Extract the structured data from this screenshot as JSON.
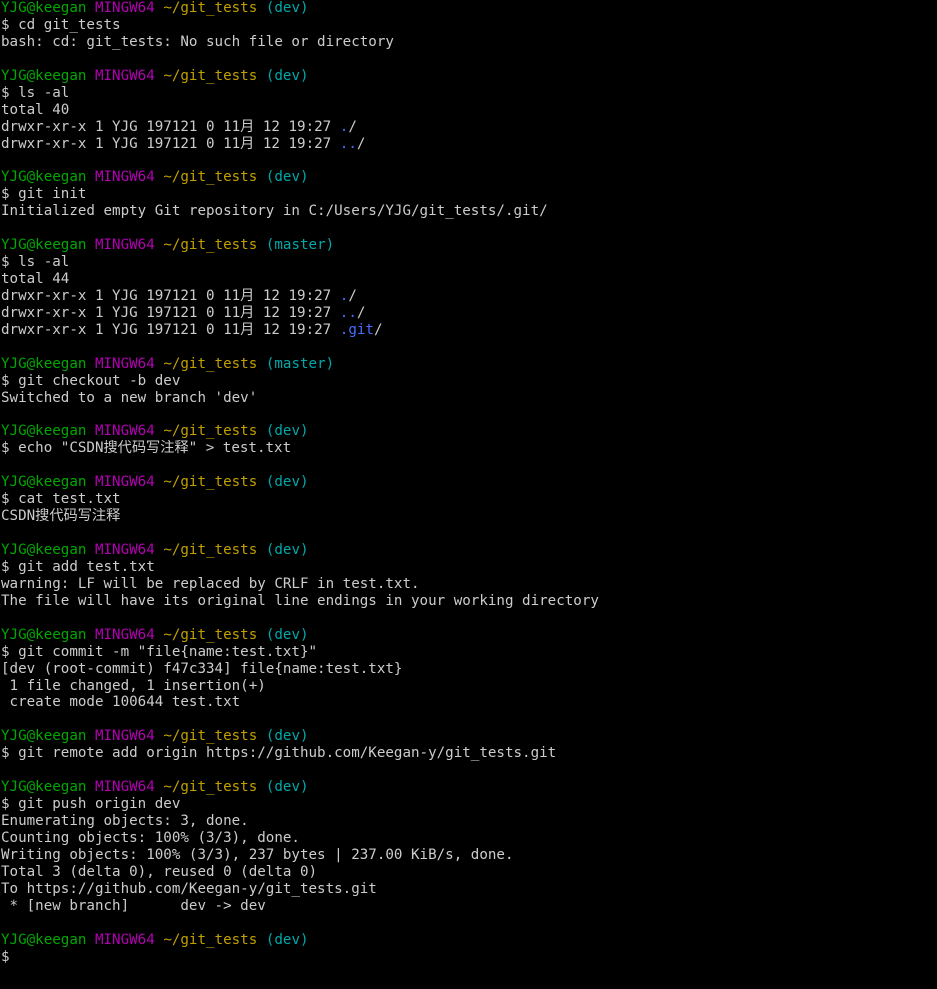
{
  "theme": {
    "background": "#000000",
    "foreground": "#cccccc",
    "prompt_user_color": "#00a800",
    "prompt_msystem_color": "#b200b2",
    "prompt_path_color": "#c0a000",
    "prompt_branch_color": "#00a8a8",
    "directory_color": "#4a6cff"
  },
  "lines": [
    {
      "kind": "prompt",
      "user": "YJG@keegan",
      "msystem": "MINGW64",
      "path": "~/git_tests",
      "branch": "(dev)"
    },
    {
      "kind": "text",
      "text": "$ cd git_tests"
    },
    {
      "kind": "text",
      "text": "bash: cd: git_tests: No such file or directory"
    },
    {
      "kind": "blank"
    },
    {
      "kind": "prompt",
      "user": "YJG@keegan",
      "msystem": "MINGW64",
      "path": "~/git_tests",
      "branch": "(dev)"
    },
    {
      "kind": "text",
      "text": "$ ls -al"
    },
    {
      "kind": "text",
      "text": "total 40"
    },
    {
      "kind": "listing",
      "prefix": "drwxr-xr-x 1 YJG 197121 0 11月 12 19:27 ",
      "name": ".",
      "suffix": "/"
    },
    {
      "kind": "listing",
      "prefix": "drwxr-xr-x 1 YJG 197121 0 11月 12 19:27 ",
      "name": "..",
      "suffix": "/"
    },
    {
      "kind": "blank"
    },
    {
      "kind": "prompt",
      "user": "YJG@keegan",
      "msystem": "MINGW64",
      "path": "~/git_tests",
      "branch": "(dev)"
    },
    {
      "kind": "text",
      "text": "$ git init"
    },
    {
      "kind": "text",
      "text": "Initialized empty Git repository in C:/Users/YJG/git_tests/.git/"
    },
    {
      "kind": "blank"
    },
    {
      "kind": "prompt",
      "user": "YJG@keegan",
      "msystem": "MINGW64",
      "path": "~/git_tests",
      "branch": "(master)"
    },
    {
      "kind": "text",
      "text": "$ ls -al"
    },
    {
      "kind": "text",
      "text": "total 44"
    },
    {
      "kind": "listing",
      "prefix": "drwxr-xr-x 1 YJG 197121 0 11月 12 19:27 ",
      "name": ".",
      "suffix": "/"
    },
    {
      "kind": "listing",
      "prefix": "drwxr-xr-x 1 YJG 197121 0 11月 12 19:27 ",
      "name": "..",
      "suffix": "/"
    },
    {
      "kind": "listing",
      "prefix": "drwxr-xr-x 1 YJG 197121 0 11月 12 19:27 ",
      "name": ".git",
      "suffix": "/"
    },
    {
      "kind": "blank"
    },
    {
      "kind": "prompt",
      "user": "YJG@keegan",
      "msystem": "MINGW64",
      "path": "~/git_tests",
      "branch": "(master)"
    },
    {
      "kind": "text",
      "text": "$ git checkout -b dev"
    },
    {
      "kind": "text",
      "text": "Switched to a new branch 'dev'"
    },
    {
      "kind": "blank"
    },
    {
      "kind": "prompt",
      "user": "YJG@keegan",
      "msystem": "MINGW64",
      "path": "~/git_tests",
      "branch": "(dev)"
    },
    {
      "kind": "text",
      "text": "$ echo \"CSDN搜代码写注释\" > test.txt"
    },
    {
      "kind": "blank"
    },
    {
      "kind": "prompt",
      "user": "YJG@keegan",
      "msystem": "MINGW64",
      "path": "~/git_tests",
      "branch": "(dev)"
    },
    {
      "kind": "text",
      "text": "$ cat test.txt"
    },
    {
      "kind": "text",
      "text": "CSDN搜代码写注释"
    },
    {
      "kind": "blank"
    },
    {
      "kind": "prompt",
      "user": "YJG@keegan",
      "msystem": "MINGW64",
      "path": "~/git_tests",
      "branch": "(dev)"
    },
    {
      "kind": "text",
      "text": "$ git add test.txt"
    },
    {
      "kind": "text",
      "text": "warning: LF will be replaced by CRLF in test.txt."
    },
    {
      "kind": "text",
      "text": "The file will have its original line endings in your working directory"
    },
    {
      "kind": "blank"
    },
    {
      "kind": "prompt",
      "user": "YJG@keegan",
      "msystem": "MINGW64",
      "path": "~/git_tests",
      "branch": "(dev)"
    },
    {
      "kind": "text",
      "text": "$ git commit -m \"file{name:test.txt}\""
    },
    {
      "kind": "text",
      "text": "[dev (root-commit) f47c334] file{name:test.txt}"
    },
    {
      "kind": "text",
      "text": " 1 file changed, 1 insertion(+)"
    },
    {
      "kind": "text",
      "text": " create mode 100644 test.txt"
    },
    {
      "kind": "blank"
    },
    {
      "kind": "prompt",
      "user": "YJG@keegan",
      "msystem": "MINGW64",
      "path": "~/git_tests",
      "branch": "(dev)"
    },
    {
      "kind": "text",
      "text": "$ git remote add origin https://github.com/Keegan-y/git_tests.git"
    },
    {
      "kind": "blank"
    },
    {
      "kind": "prompt",
      "user": "YJG@keegan",
      "msystem": "MINGW64",
      "path": "~/git_tests",
      "branch": "(dev)"
    },
    {
      "kind": "text",
      "text": "$ git push origin dev"
    },
    {
      "kind": "text",
      "text": "Enumerating objects: 3, done."
    },
    {
      "kind": "text",
      "text": "Counting objects: 100% (3/3), done."
    },
    {
      "kind": "text",
      "text": "Writing objects: 100% (3/3), 237 bytes | 237.00 KiB/s, done."
    },
    {
      "kind": "text",
      "text": "Total 3 (delta 0), reused 0 (delta 0)"
    },
    {
      "kind": "text",
      "text": "To https://github.com/Keegan-y/git_tests.git"
    },
    {
      "kind": "text",
      "text": " * [new branch]      dev -> dev"
    },
    {
      "kind": "blank"
    },
    {
      "kind": "prompt",
      "user": "YJG@keegan",
      "msystem": "MINGW64",
      "path": "~/git_tests",
      "branch": "(dev)"
    },
    {
      "kind": "text",
      "text": "$"
    }
  ]
}
